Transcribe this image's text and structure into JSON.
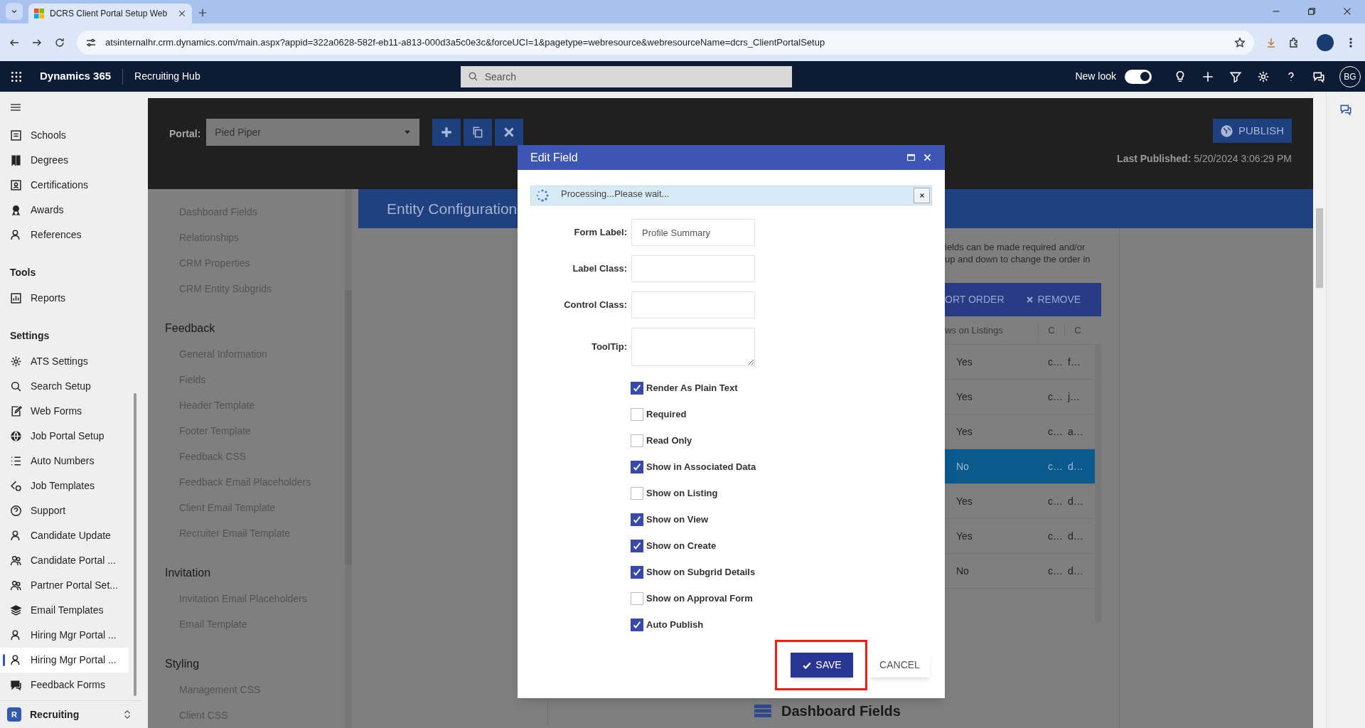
{
  "browser": {
    "tab_title": "DCRS Client Portal Setup Web",
    "url": "atsinternalhr.crm.dynamics.com/main.aspx?appid=322a0628-582f-eb11-a813-000d3a5c0e3c&forceUCI=1&pagetype=webresource&webresourceName=dcrs_ClientPortalSetup"
  },
  "app_header": {
    "product": "Dynamics 365",
    "app_name": "Recruiting Hub",
    "search": {
      "placeholder": "Search"
    },
    "new_look": {
      "label": "New look",
      "on": true
    },
    "avatar": "BG"
  },
  "sidebar": {
    "groups": [
      {
        "items": [
          {
            "label": "Schools",
            "selected": false
          },
          {
            "label": "Degrees",
            "selected": false
          },
          {
            "label": "Certifications",
            "selected": false
          },
          {
            "label": "Awards",
            "selected": false
          },
          {
            "label": "References",
            "selected": false
          }
        ]
      },
      {
        "title": "Tools",
        "items": [
          {
            "label": "Reports",
            "selected": false
          }
        ]
      },
      {
        "title": "Settings",
        "items": [
          {
            "label": "ATS Settings",
            "selected": false
          },
          {
            "label": "Search Setup",
            "selected": false
          },
          {
            "label": "Web Forms",
            "selected": false
          },
          {
            "label": "Job Portal Setup",
            "selected": false
          },
          {
            "label": "Auto Numbers",
            "selected": false
          },
          {
            "label": "Job Templates",
            "selected": false
          },
          {
            "label": "Support",
            "selected": false
          },
          {
            "label": "Candidate Update",
            "selected": false
          },
          {
            "label": "Candidate Portal ...",
            "selected": false
          },
          {
            "label": "Partner Portal Set...",
            "selected": false
          },
          {
            "label": "Email Templates",
            "selected": false
          },
          {
            "label": "Hiring Mgr Portal ...",
            "selected": false
          },
          {
            "label": "Hiring Mgr Portal ...",
            "selected": true
          },
          {
            "label": "Feedback Forms",
            "selected": false
          }
        ]
      }
    ],
    "area": {
      "badge": "R",
      "label": "Recruiting"
    }
  },
  "portal_toolbar": {
    "label": "Portal:",
    "selected_portal": "Pied Piper",
    "publish": "PUBLISH",
    "last_published_label": "Last Published:",
    "last_published": "5/20/2024 3:06:29 PM"
  },
  "config_nav": [
    {
      "items": [
        "Dashboard Fields",
        "Relationships",
        "CRM Properties",
        "CRM Entity Subgrids"
      ]
    },
    {
      "title": "Feedback",
      "items": [
        "General Information",
        "Fields",
        "Header Template",
        "Footer Template",
        "Feedback CSS",
        "Feedback Email Placeholders",
        "Client Email Template",
        "Recruiter Email Template"
      ]
    },
    {
      "title": "Invitation",
      "items": [
        "Invitation Email Placeholders",
        "Email Template"
      ]
    },
    {
      "title": "Styling",
      "items": [
        "Management CSS",
        "Client CSS"
      ]
    }
  ],
  "entity_panel": {
    "title": "Entity Configuration",
    "description_lines": [
      "ields can be made required and/or",
      "up and down to change the order in"
    ],
    "toolbar": [
      {
        "label": "ORT ORDER",
        "kind": "text"
      },
      {
        "label": "REMOVE",
        "kind": "remove"
      }
    ],
    "columns": [
      "ws on Listings",
      "C",
      "C"
    ],
    "rows": [
      {
        "cells": [
          "Yes",
          "c…",
          "f…"
        ],
        "selected": false
      },
      {
        "cells": [
          "Yes",
          "c…",
          "j…"
        ],
        "selected": false
      },
      {
        "cells": [
          "Yes",
          "c…",
          "a…"
        ],
        "selected": false
      },
      {
        "cells": [
          "No",
          "c…",
          "d…"
        ],
        "selected": true
      },
      {
        "cells": [
          "Yes",
          "c…",
          "d…"
        ],
        "selected": false
      },
      {
        "cells": [
          "Yes",
          "c…",
          "d…"
        ],
        "selected": false
      },
      {
        "cells": [
          "No",
          "c…",
          "d…"
        ],
        "selected": false
      }
    ],
    "section_title": "Dashboard Fields"
  },
  "dialog": {
    "title": "Edit Field",
    "message": "Processing...Please wait...",
    "fields": [
      {
        "label": "Form Label:",
        "kind": "input",
        "value": "Profile Summary"
      },
      {
        "label": "Label Class:",
        "kind": "input"
      },
      {
        "label": "Control Class:",
        "kind": "input"
      },
      {
        "label": "ToolTip:",
        "kind": "textarea"
      }
    ],
    "options": [
      {
        "label": "Render As Plain Text",
        "checked": true
      },
      {
        "label": "Required",
        "checked": false
      },
      {
        "label": "Read Only",
        "checked": false
      },
      {
        "label": "Show in Associated Data",
        "checked": true
      },
      {
        "label": "Show on Listing",
        "checked": false
      },
      {
        "label": "Show on View",
        "checked": true
      },
      {
        "label": "Show on Create",
        "checked": true
      },
      {
        "label": "Show on Subgrid Details",
        "checked": true
      },
      {
        "label": "Show on Approval Form",
        "checked": false
      },
      {
        "label": "Auto Publish",
        "checked": true
      }
    ],
    "buttons": [
      {
        "label": "SAVE",
        "kind": "primary"
      },
      {
        "label": "CANCEL",
        "kind": "secondary"
      }
    ]
  }
}
